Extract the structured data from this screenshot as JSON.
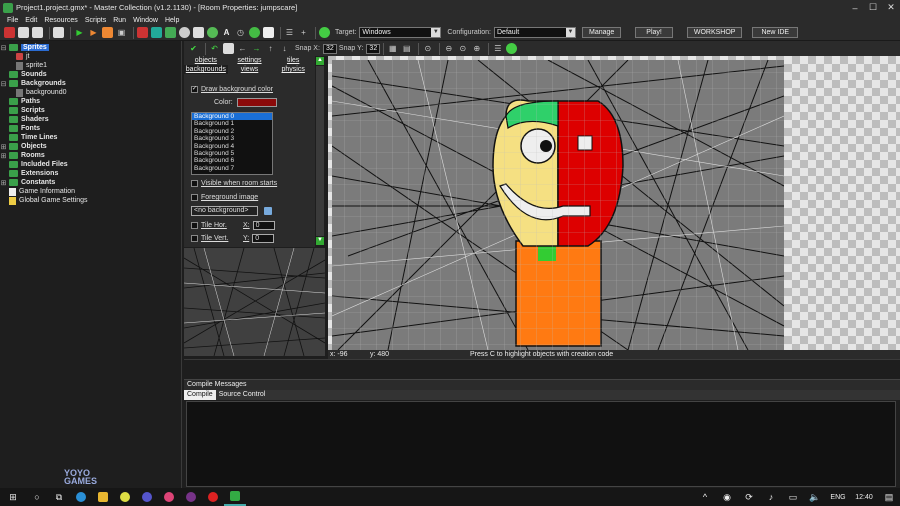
{
  "window": {
    "title": "Project1.project.gmx* - Master Collection (v1.2.1130) - [Room Properties: jumpscare]"
  },
  "menu": [
    "File",
    "Edit",
    "Resources",
    "Scripts",
    "Run",
    "Window",
    "Help"
  ],
  "toolbar": {
    "target_label": "Target:",
    "target_value": "Windows",
    "config_label": "Configuration:",
    "config_value": "Default",
    "manage": "Manage",
    "play": "Play!",
    "workshop": "WORKSHOP",
    "new_ide": "New IDE"
  },
  "tree": {
    "sprites": "Sprites",
    "sprite_jt": "jt",
    "sprite1": "sprite1",
    "sounds": "Sounds",
    "backgrounds": "Backgrounds",
    "background0": "background0",
    "paths": "Paths",
    "scripts": "Scripts",
    "shaders": "Shaders",
    "fonts": "Fonts",
    "timelines": "Time Lines",
    "objects": "Objects",
    "rooms": "Rooms",
    "included": "Included Files",
    "extensions": "Extensions",
    "constants": "Constants",
    "gameinfo": "Game Information",
    "globalsettings": "Global Game Settings"
  },
  "logo": {
    "line1": "YOYO",
    "line2": "GAMES"
  },
  "editor": {
    "snapx_label": "Snap X:",
    "snapx": "32",
    "snapy_label": "Snap Y:",
    "snapy": "32"
  },
  "props": {
    "tabs1": [
      "objects",
      "settings",
      "tiles"
    ],
    "tabs2": [
      "backgrounds",
      "views",
      "physics"
    ],
    "draw_bg": "Draw background color",
    "color_label": "Color:",
    "bg_color": "#8b0a0a",
    "backgrounds": [
      "Background 0",
      "Background 1",
      "Background 2",
      "Background 3",
      "Background 4",
      "Background 5",
      "Background 6",
      "Background 7"
    ],
    "visible_start": "Visible when room starts",
    "foreground": "Foreground image",
    "no_bg": "<no background>",
    "tile_hor": "Tile Hor.",
    "tile_vert": "Tile Vert.",
    "x_label": "X:",
    "x_value": "0",
    "y_label": "Y:",
    "y_value": "0"
  },
  "status": {
    "x": "x: -96",
    "y": "y: 480",
    "hint": "Press C to highlight objects with creation code"
  },
  "compile": {
    "title": "Compile Messages",
    "tab_compile": "Compile",
    "tab_source": "Source Control"
  },
  "taskbar": {
    "lang": "ENG",
    "time": "12:40"
  }
}
